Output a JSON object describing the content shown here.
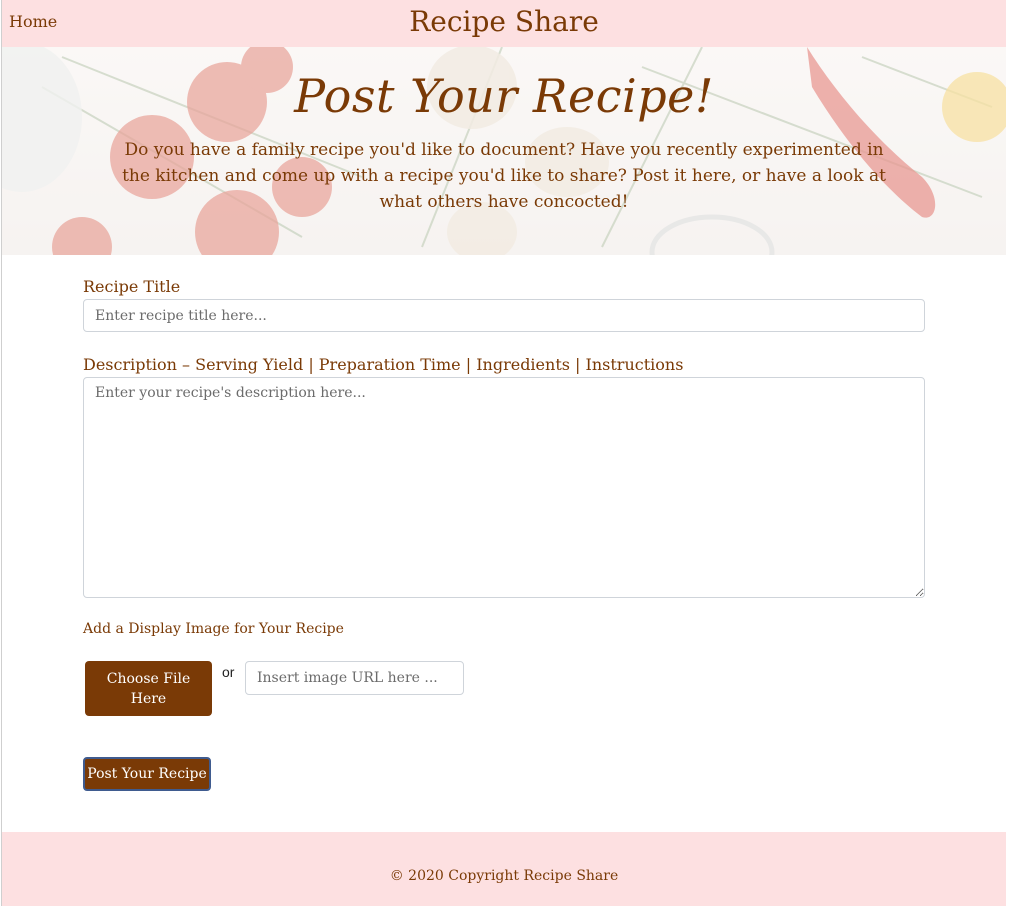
{
  "navbar": {
    "home_label": "Home",
    "brand": "Recipe Share"
  },
  "hero": {
    "title": "Post Your Recipe!",
    "intro": "Do you have a family recipe you'd like to document? Have you recently experimented in the kitchen and come up with a recipe you'd like to share? Post it here, or have a look at what others have concocted!"
  },
  "form": {
    "title_label": "Recipe Title",
    "title_placeholder": "Enter recipe title here...",
    "description_label": "Description – Serving Yield | Preparation Time | Ingredients | Instructions",
    "description_placeholder": "Enter your recipe's description here...",
    "image_label": "Add a Display Image for Your Recipe",
    "choose_file_label": "Choose File Here",
    "or_label": "or",
    "url_placeholder": "Insert image URL here ...",
    "submit_label": "Post Your Recipe"
  },
  "footer": {
    "copyright": "© 2020 Copyright Recipe Share"
  },
  "colors": {
    "brand_brown": "#7a3a06",
    "nav_pink": "#fde0e1",
    "button_border": "#3f5b8f"
  }
}
